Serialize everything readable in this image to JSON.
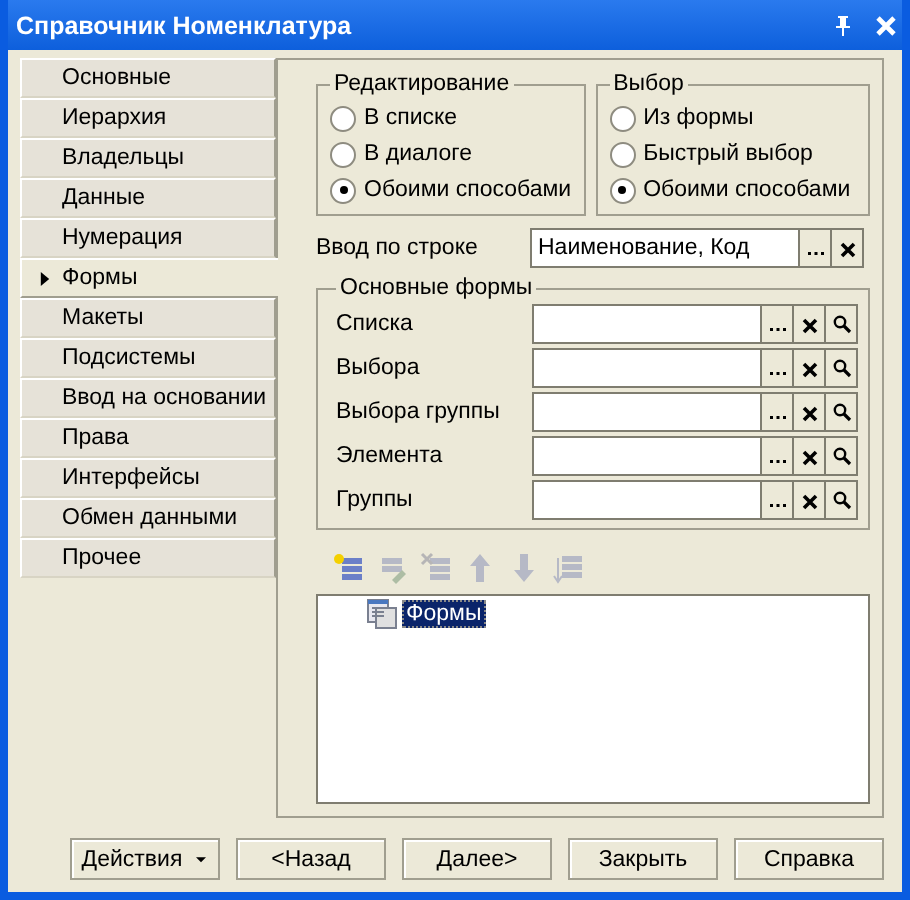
{
  "window": {
    "title": "Справочник Номенклатура"
  },
  "tabs": [
    {
      "label": "Основные",
      "selected": false
    },
    {
      "label": "Иерархия",
      "selected": false
    },
    {
      "label": "Владельцы",
      "selected": false
    },
    {
      "label": "Данные",
      "selected": false
    },
    {
      "label": "Нумерация",
      "selected": false
    },
    {
      "label": "Формы",
      "selected": true
    },
    {
      "label": "Макеты",
      "selected": false
    },
    {
      "label": "Подсистемы",
      "selected": false
    },
    {
      "label": "Ввод на основании",
      "selected": false
    },
    {
      "label": "Права",
      "selected": false
    },
    {
      "label": "Интерфейсы",
      "selected": false
    },
    {
      "label": "Обмен данными",
      "selected": false
    },
    {
      "label": "Прочее",
      "selected": false
    }
  ],
  "groups": [
    {
      "title": "Редактирование",
      "options": [
        {
          "label": "В списке",
          "selected": false
        },
        {
          "label": "В диалоге",
          "selected": false
        },
        {
          "label": "Обоими способами",
          "selected": true
        }
      ]
    },
    {
      "title": "Выбор",
      "options": [
        {
          "label": "Из формы",
          "selected": false
        },
        {
          "label": "Быстрый выбор",
          "selected": false
        },
        {
          "label": "Обоими способами",
          "selected": true
        }
      ]
    }
  ],
  "input_by_string": {
    "label": "Ввод по строке",
    "value": "Наименование, Код"
  },
  "main_forms": {
    "title": "Основные формы",
    "fields": [
      {
        "label": "Списка"
      },
      {
        "label": "Выбора"
      },
      {
        "label": "Выбора группы"
      },
      {
        "label": "Элемента"
      },
      {
        "label": "Группы"
      }
    ]
  },
  "toolbar": [
    {
      "kind": "add",
      "disabled": false
    },
    {
      "kind": "edit",
      "disabled": true
    },
    {
      "kind": "delete",
      "disabled": true
    },
    {
      "kind": "up",
      "disabled": true
    },
    {
      "kind": "down",
      "disabled": true
    },
    {
      "kind": "sort",
      "disabled": true
    }
  ],
  "tree": [
    {
      "label": "Формы",
      "selected": true
    }
  ],
  "buttons": [
    {
      "label": "Действия",
      "kind": "menu"
    },
    {
      "label": "<Назад",
      "kind": "plain"
    },
    {
      "label": "Далее>",
      "kind": "plain"
    },
    {
      "label": "Закрыть",
      "kind": "plain"
    },
    {
      "label": "Справка",
      "kind": "plain"
    }
  ]
}
